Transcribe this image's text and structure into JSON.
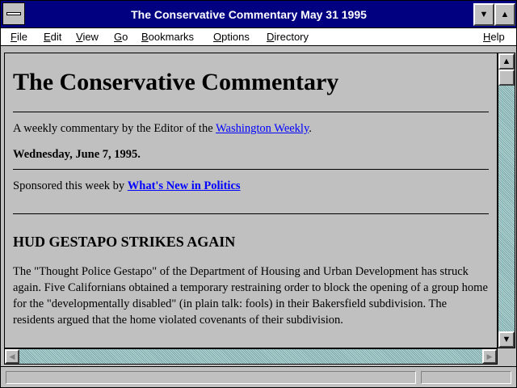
{
  "window": {
    "title": "The Conservative Commentary May 31 1995"
  },
  "menu": {
    "file": {
      "pre": "",
      "ul": "F",
      "post": "ile"
    },
    "edit": {
      "pre": "",
      "ul": "E",
      "post": "dit"
    },
    "view": {
      "pre": "",
      "ul": "V",
      "post": "iew"
    },
    "go": {
      "pre": "",
      "ul": "G",
      "post": "o"
    },
    "bookmarks": {
      "pre": "",
      "ul": "B",
      "post": "ookmarks"
    },
    "options": {
      "pre": "",
      "ul": "O",
      "post": "ptions"
    },
    "directory": {
      "pre": "",
      "ul": "D",
      "post": "irectory"
    },
    "help": {
      "pre": "",
      "ul": "H",
      "post": "elp"
    }
  },
  "page": {
    "heading": "The Conservative Commentary",
    "intro_prefix": "A weekly commentary by the Editor of the ",
    "intro_link": "Washington Weekly",
    "intro_suffix": ".",
    "date": "Wednesday, June 7, 1995.",
    "sponsor_prefix": "Sponsored this week by ",
    "sponsor_link": "What's New in Politics",
    "article_title": "HUD GESTAPO STRIKES AGAIN",
    "article_body": "The \"Thought Police Gestapo\" of the Department of Housing and Urban Development has struck again. Five Californians obtained a temporary restraining order to block the opening of a group home for the \"developmentally disabled\" (in plain talk: fools) in their Bakersfield subdivision. The residents argued that the home violated covenants of their subdivision."
  },
  "icons": {
    "scroll_up": "▲",
    "scroll_down": "▼",
    "scroll_left": "◀",
    "scroll_right": "▶",
    "minimize": "▼",
    "maximize": "▲"
  }
}
